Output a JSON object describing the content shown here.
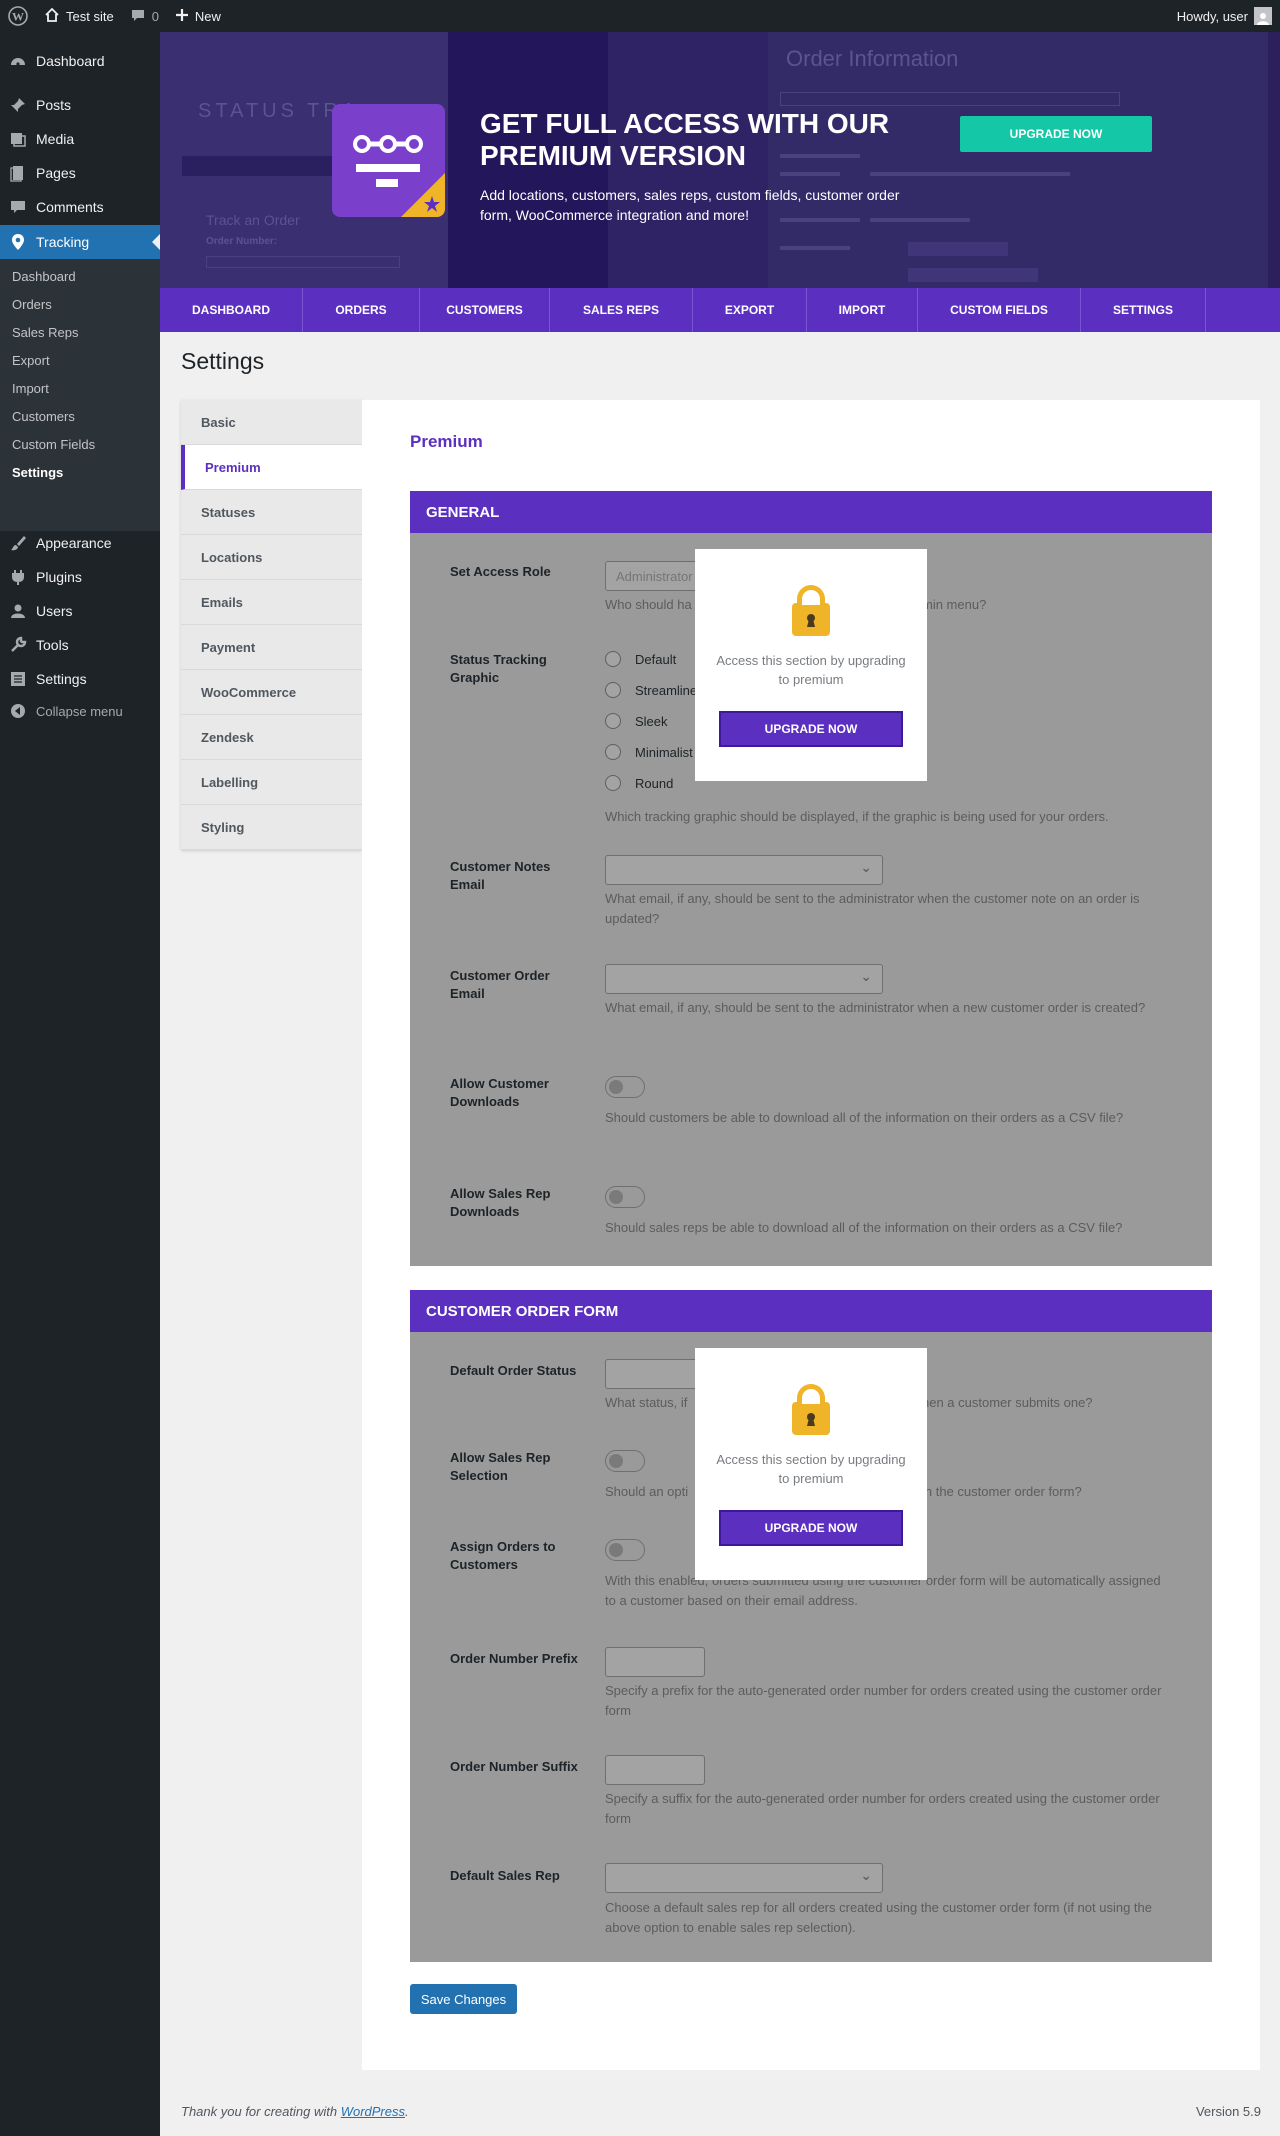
{
  "adminbar": {
    "site_name": "Test site",
    "comments_count": "0",
    "new_label": "New",
    "howdy": "Howdy, user"
  },
  "sidebar": {
    "items": [
      {
        "label": "Dashboard",
        "icon": "dashboard-icon"
      },
      {
        "label": "Posts",
        "icon": "pin-icon"
      },
      {
        "label": "Media",
        "icon": "media-icon"
      },
      {
        "label": "Pages",
        "icon": "pages-icon"
      },
      {
        "label": "Comments",
        "icon": "comment-icon"
      },
      {
        "label": "Tracking",
        "icon": "location-icon"
      },
      {
        "label": "Appearance",
        "icon": "brush-icon"
      },
      {
        "label": "Plugins",
        "icon": "plug-icon"
      },
      {
        "label": "Users",
        "icon": "user-icon"
      },
      {
        "label": "Tools",
        "icon": "wrench-icon"
      },
      {
        "label": "Settings",
        "icon": "settings-icon"
      }
    ],
    "submenu": [
      "Dashboard",
      "Orders",
      "Sales Reps",
      "Export",
      "Import",
      "Customers",
      "Custom Fields",
      "Settings"
    ],
    "collapse_label": "Collapse menu"
  },
  "banner": {
    "title": "GET FULL ACCESS WITH OUR PREMIUM VERSION",
    "subtitle": "Add locations, customers, sales reps, custom fields, customer order form, WooCommerce integration and more!",
    "upgrade_label": "UPGRADE NOW",
    "ghost_status": "STATUS TRA",
    "ghost_order_info": "Order Information",
    "ghost_track": "Track an Order",
    "ghost_order_number": "Order Number:"
  },
  "tabs": [
    "DASHBOARD",
    "ORDERS",
    "CUSTOMERS",
    "SALES REPS",
    "EXPORT",
    "IMPORT",
    "CUSTOM FIELDS",
    "SETTINGS"
  ],
  "page_title": "Settings",
  "settings_nav": [
    "Basic",
    "Premium",
    "Statuses",
    "Locations",
    "Emails",
    "Payment",
    "WooCommerce",
    "Zendesk",
    "Labelling",
    "Styling"
  ],
  "panel_title": "Premium",
  "general": {
    "header": "GENERAL",
    "access_role": {
      "label": "Set Access Role",
      "placeholder": "Administrator",
      "desc_a": "Who should ha",
      "desc_b": "min menu?"
    },
    "status_graphic": {
      "label": "Status Tracking Graphic",
      "options": [
        "Default",
        "Streamline",
        "Sleek",
        "Minimalist",
        "Round"
      ],
      "desc": "Which tracking graphic should be displayed, if the graphic is being used for your orders."
    },
    "customer_notes_email": {
      "label": "Customer Notes Email",
      "desc": "What email, if any, should be sent to the administrator when the customer note on an order is updated?"
    },
    "customer_order_email": {
      "label": "Customer Order Email",
      "desc": "What email, if any, should be sent to the administrator when a new customer order is created?"
    },
    "allow_customer_downloads": {
      "label": "Allow Customer Downloads",
      "desc": "Should customers be able to download all of the information on their orders as a CSV file?"
    },
    "allow_salesrep_downloads": {
      "label": "Allow Sales Rep Downloads",
      "desc": "Should sales reps be able to download all of the information on their orders as a CSV file?"
    }
  },
  "order_form": {
    "header": "CUSTOMER ORDER FORM",
    "default_status": {
      "label": "Default Order Status",
      "desc_a": "What status, if",
      "desc_b": "hen a customer submits one?"
    },
    "allow_salesrep_selection": {
      "label": "Allow Sales Rep Selection",
      "desc_a": "Should an opti",
      "desc_b": "in the customer order form?"
    },
    "assign_orders": {
      "label": "Assign Orders to Customers",
      "desc": "With this enabled, orders submitted using the customer order form will be automatically assigned to a customer based on their email address."
    },
    "order_prefix": {
      "label": "Order Number Prefix",
      "desc": "Specify a prefix for the auto-generated order number for orders created using the customer order form"
    },
    "order_suffix": {
      "label": "Order Number Suffix",
      "desc": "Specify a suffix for the auto-generated order number for orders created using the customer order form"
    },
    "default_salesrep": {
      "label": "Default Sales Rep",
      "desc": "Choose a default sales rep for all orders created using the customer order form (if not using the above option to enable sales rep selection)."
    }
  },
  "lock": {
    "message": "Access this section by upgrading to premium",
    "button": "UPGRADE NOW"
  },
  "save_label": "Save Changes",
  "footer": {
    "thanks_prefix": "Thank you for creating with ",
    "link": "WordPress",
    "suffix": ".",
    "version": "Version 5.9"
  },
  "colors": {
    "accent": "#5b2fc0",
    "wp_blue": "#2271b1",
    "teal": "#14c7a6",
    "lock_yellow": "#f0b429"
  }
}
